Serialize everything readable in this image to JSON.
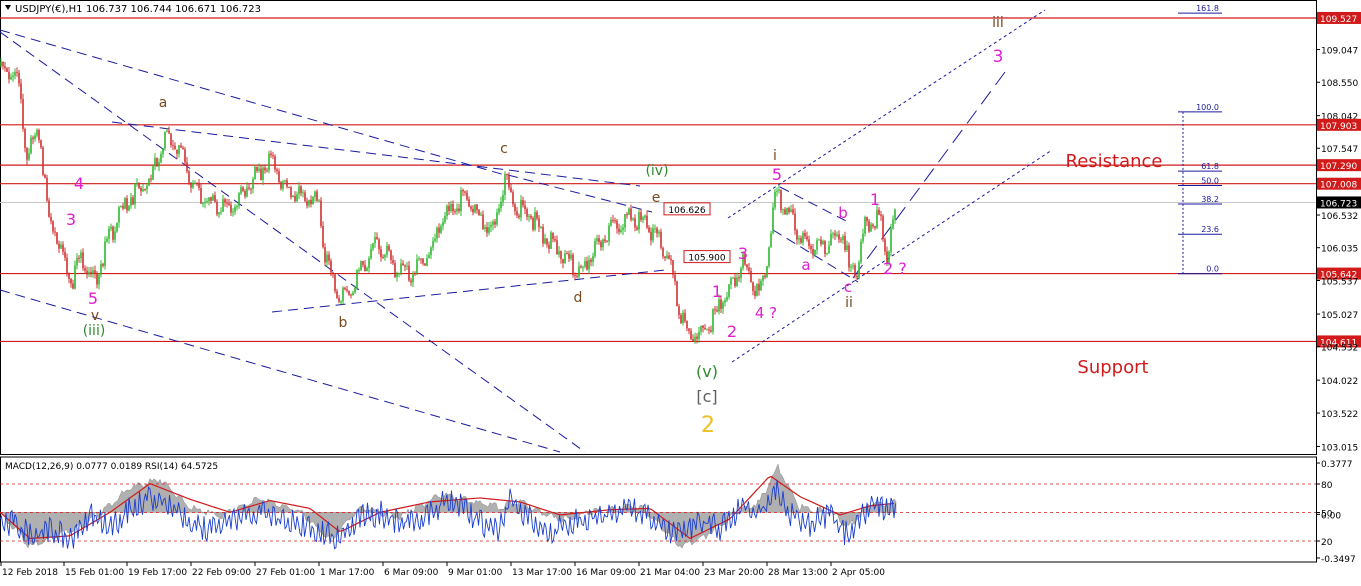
{
  "header": {
    "symbol": "USDJPY(€),H1",
    "ohlc": "106.737 106.744 106.671 106.723",
    "indicator_header": "MACD(12,26,9) 0.0777 0.0189 RSI(14) 64.5725"
  },
  "colors": {
    "background": "#ffffff",
    "grid_border": "#000000",
    "candle_up": "#2db82d",
    "candle_down": "#d03030",
    "hline": "#d11b1b",
    "trendline": "#1a1aa0",
    "wave_magenta": "#e020d0",
    "wave_brown": "#7a4a1f",
    "wave_green": "#2e8b2e",
    "wave_gray": "#606060",
    "wave_gold": "#f0c020",
    "macd_hist": "#b0b0b0",
    "macd_signal": "#d11b1b",
    "rsi": "#1a3fd0",
    "fib": "#1a1aa0"
  },
  "chart_data": {
    "type": "candlestick",
    "symbol": "USDJPY",
    "timeframe": "H1",
    "ylim": [
      102.9,
      109.8
    ],
    "y_ticks": [
      {
        "value": 109.527,
        "label": "109.527",
        "highlight": true
      },
      {
        "value": 109.047,
        "label": "109.047"
      },
      {
        "value": 108.55,
        "label": "108.550"
      },
      {
        "value": 108.042,
        "label": "108.042"
      },
      {
        "value": 107.903,
        "label": "107.903",
        "highlight": true
      },
      {
        "value": 107.547,
        "label": "107.547"
      },
      {
        "value": 107.29,
        "label": "107.290",
        "highlight": true
      },
      {
        "value": 107.008,
        "label": "107.008",
        "highlight": true
      },
      {
        "value": 106.723,
        "label": "106.723",
        "current": true
      },
      {
        "value": 106.532,
        "label": "106.532"
      },
      {
        "value": 106.035,
        "label": "106.035"
      },
      {
        "value": 105.642,
        "label": "105.642",
        "highlight": true
      },
      {
        "value": 105.537,
        "label": "105.537"
      },
      {
        "value": 105.027,
        "label": "105.027"
      },
      {
        "value": 104.611,
        "label": "104.611",
        "highlight": true
      },
      {
        "value": 104.532,
        "label": "104.532"
      },
      {
        "value": 104.022,
        "label": "104.022"
      },
      {
        "value": 103.522,
        "label": "103.522"
      },
      {
        "value": 103.015,
        "label": "103.015"
      }
    ],
    "x_ticks": [
      "12 Feb 2018",
      "15 Feb 01:00",
      "19 Feb 17:00",
      "22 Feb 09:00",
      "27 Feb 01:00",
      "1 Mar 17:00",
      "6 Mar 09:00",
      "9 Mar 01:00",
      "13 Mar 17:00",
      "16 Mar 09:00",
      "21 Mar 04:00",
      "23 Mar 20:00",
      "28 Mar 13:00",
      "2 Apr 05:00"
    ],
    "price_path": [
      [
        0,
        108.8
      ],
      [
        18,
        108.7
      ],
      [
        26,
        107.6
      ],
      [
        40,
        107.8
      ],
      [
        48,
        106.6
      ],
      [
        60,
        106.2
      ],
      [
        72,
        105.6
      ],
      [
        80,
        106.0
      ],
      [
        95,
        105.6
      ],
      [
        110,
        106.3
      ],
      [
        130,
        106.9
      ],
      [
        150,
        107.1
      ],
      [
        165,
        107.8
      ],
      [
        180,
        107.6
      ],
      [
        195,
        107.0
      ],
      [
        210,
        106.8
      ],
      [
        230,
        106.7
      ],
      [
        250,
        107.1
      ],
      [
        272,
        107.5
      ],
      [
        285,
        107.0
      ],
      [
        300,
        106.9
      ],
      [
        318,
        106.8
      ],
      [
        325,
        106.0
      ],
      [
        338,
        105.3
      ],
      [
        352,
        105.5
      ],
      [
        365,
        105.9
      ],
      [
        378,
        106.2
      ],
      [
        395,
        105.8
      ],
      [
        410,
        105.7
      ],
      [
        428,
        106.0
      ],
      [
        445,
        106.6
      ],
      [
        465,
        106.9
      ],
      [
        480,
        106.5
      ],
      [
        495,
        106.4
      ],
      [
        505,
        107.2
      ],
      [
        512,
        106.8
      ],
      [
        530,
        106.6
      ],
      [
        550,
        106.2
      ],
      [
        565,
        106.0
      ],
      [
        578,
        105.7
      ],
      [
        592,
        106.0
      ],
      [
        605,
        106.3
      ],
      [
        625,
        106.6
      ],
      [
        645,
        106.5
      ],
      [
        655,
        106.3
      ],
      [
        668,
        106.0
      ],
      [
        680,
        105.1
      ],
      [
        688,
        104.8
      ],
      [
        700,
        104.8
      ],
      [
        712,
        105.0
      ],
      [
        726,
        105.4
      ],
      [
        742,
        105.9
      ],
      [
        752,
        105.6
      ],
      [
        760,
        105.4
      ],
      [
        768,
        106.0
      ],
      [
        776,
        107.0
      ],
      [
        785,
        106.7
      ],
      [
        800,
        106.3
      ],
      [
        812,
        106.1
      ],
      [
        830,
        106.2
      ],
      [
        843,
        106.4
      ],
      [
        850,
        105.7
      ],
      [
        857,
        105.8
      ],
      [
        866,
        106.5
      ],
      [
        880,
        106.6
      ],
      [
        887,
        106.0
      ],
      [
        896,
        106.72
      ]
    ],
    "horizontal_levels": [
      {
        "value": 109.527
      },
      {
        "value": 107.903
      },
      {
        "value": 107.29
      },
      {
        "value": 107.008
      },
      {
        "value": 105.642
      },
      {
        "value": 104.611
      }
    ],
    "price_tags": [
      {
        "text": "106.626",
        "value": 106.626
      },
      {
        "text": "105.900",
        "value": 105.9
      }
    ],
    "fibonacci_levels": [
      {
        "label": "161.8",
        "value": 109.6
      },
      {
        "label": "100.0",
        "value": 108.1
      },
      {
        "label": "61.8",
        "value": 107.2
      },
      {
        "label": "50.0",
        "value": 106.98
      },
      {
        "label": "38.2",
        "value": 106.7
      },
      {
        "label": "23.6",
        "value": 106.24
      },
      {
        "label": "0.0",
        "value": 105.64
      }
    ],
    "annotations": [
      {
        "text": "Resistance"
      },
      {
        "text": "Support"
      }
    ],
    "wave_labels": [
      "a",
      "c",
      "(iv)",
      "e",
      "i",
      "5",
      "1",
      "b",
      "iii",
      "3",
      "4",
      "3",
      "5",
      "v",
      "(iii)",
      "b",
      "d",
      "3",
      "1",
      "2",
      "4 ?",
      "a",
      "c",
      "ii",
      "2 ?",
      "(v)",
      "[c]",
      "2"
    ],
    "macd_rsi": {
      "title": "MACD(12,26,9) 0.0777 0.0189 RSI(14) 64.5725",
      "ticks": [
        {
          "label": "0.3777"
        },
        {
          "label": "80"
        },
        {
          "label": "50"
        },
        {
          "label": "0.00"
        },
        {
          "label": "20"
        },
        {
          "label": "-0.3497"
        }
      ],
      "rsi_path": [
        [
          0,
          50
        ],
        [
          20,
          42
        ],
        [
          35,
          30
        ],
        [
          50,
          40
        ],
        [
          70,
          28
        ],
        [
          90,
          55
        ],
        [
          110,
          40
        ],
        [
          130,
          60
        ],
        [
          150,
          72
        ],
        [
          170,
          64
        ],
        [
          190,
          45
        ],
        [
          210,
          40
        ],
        [
          240,
          52
        ],
        [
          265,
          62
        ],
        [
          280,
          48
        ],
        [
          300,
          45
        ],
        [
          320,
          36
        ],
        [
          340,
          30
        ],
        [
          360,
          52
        ],
        [
          380,
          56
        ],
        [
          400,
          46
        ],
        [
          420,
          50
        ],
        [
          445,
          68
        ],
        [
          460,
          66
        ],
        [
          480,
          46
        ],
        [
          500,
          40
        ],
        [
          510,
          72
        ],
        [
          530,
          50
        ],
        [
          550,
          38
        ],
        [
          570,
          46
        ],
        [
          600,
          52
        ],
        [
          630,
          62
        ],
        [
          650,
          50
        ],
        [
          670,
          34
        ],
        [
          690,
          42
        ],
        [
          705,
          47
        ],
        [
          720,
          40
        ],
        [
          740,
          62
        ],
        [
          760,
          56
        ],
        [
          776,
          82
        ],
        [
          790,
          56
        ],
        [
          810,
          45
        ],
        [
          830,
          55
        ],
        [
          848,
          32
        ],
        [
          860,
          52
        ],
        [
          870,
          64
        ],
        [
          885,
          60
        ],
        [
          896,
          64
        ]
      ],
      "hist_path": [
        [
          0,
          0.02
        ],
        [
          30,
          -0.25
        ],
        [
          60,
          -0.15
        ],
        [
          90,
          -0.05
        ],
        [
          130,
          0.2
        ],
        [
          160,
          0.27
        ],
        [
          190,
          0.05
        ],
        [
          220,
          -0.02
        ],
        [
          260,
          0.12
        ],
        [
          300,
          0.02
        ],
        [
          330,
          -0.2
        ],
        [
          360,
          0.05
        ],
        [
          400,
          -0.02
        ],
        [
          440,
          0.15
        ],
        [
          470,
          0.1
        ],
        [
          500,
          0.05
        ],
        [
          520,
          0.1
        ],
        [
          560,
          -0.05
        ],
        [
          600,
          0.03
        ],
        [
          640,
          0.06
        ],
        [
          680,
          -0.24
        ],
        [
          700,
          -0.2
        ],
        [
          730,
          -0.02
        ],
        [
          760,
          0.1
        ],
        [
          778,
          0.37
        ],
        [
          800,
          0.05
        ],
        [
          830,
          0.02
        ],
        [
          848,
          -0.1
        ],
        [
          870,
          0.08
        ],
        [
          896,
          0.09
        ]
      ],
      "signal_path": [
        [
          0,
          0.0
        ],
        [
          30,
          -0.2
        ],
        [
          70,
          -0.18
        ],
        [
          110,
          0.0
        ],
        [
          150,
          0.22
        ],
        [
          190,
          0.1
        ],
        [
          230,
          0.0
        ],
        [
          270,
          0.09
        ],
        [
          310,
          0.03
        ],
        [
          340,
          -0.15
        ],
        [
          380,
          0.0
        ],
        [
          430,
          0.08
        ],
        [
          480,
          0.11
        ],
        [
          520,
          0.08
        ],
        [
          560,
          -0.02
        ],
        [
          610,
          0.02
        ],
        [
          650,
          0.03
        ],
        [
          690,
          -0.2
        ],
        [
          730,
          -0.05
        ],
        [
          770,
          0.28
        ],
        [
          800,
          0.12
        ],
        [
          840,
          -0.02
        ],
        [
          870,
          0.05
        ],
        [
          896,
          0.07
        ]
      ]
    }
  }
}
